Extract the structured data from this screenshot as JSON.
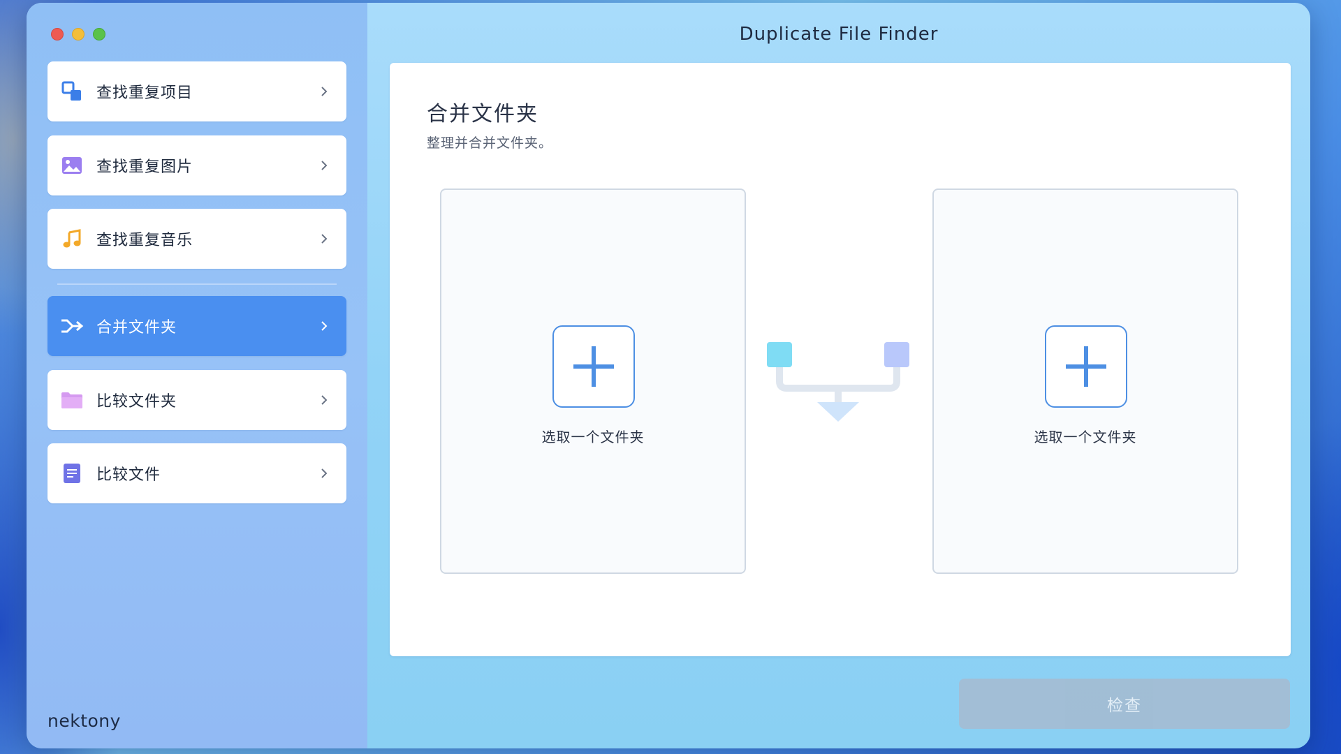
{
  "window": {
    "title": "Duplicate File Finder"
  },
  "sidebar": {
    "items": [
      {
        "label": "查找重复项目",
        "icon": "duplicate-items-icon",
        "active": false
      },
      {
        "label": "查找重复图片",
        "icon": "image-icon",
        "active": false
      },
      {
        "label": "查找重复音乐",
        "icon": "music-note-icon",
        "active": false
      },
      {
        "label": "合并文件夹",
        "icon": "merge-arrow-icon",
        "active": true
      },
      {
        "label": "比较文件夹",
        "icon": "folder-icon",
        "active": false
      },
      {
        "label": "比较文件",
        "icon": "document-icon",
        "active": false
      }
    ],
    "brand": "nektony"
  },
  "main": {
    "title": "合并文件夹",
    "subtitle": "整理并合并文件夹。",
    "left_drop": {
      "label": "选取一个文件夹"
    },
    "right_drop": {
      "label": "选取一个文件夹"
    },
    "check_button": "检查"
  },
  "colors": {
    "accent": "#4a8ff0",
    "plus": "#4d8fe3",
    "check_disabled": "#a3bdd4",
    "merge_left_square": "#7fdcf4",
    "merge_right_square": "#b9c8fb",
    "merge_connector": "#dfe6ef"
  }
}
